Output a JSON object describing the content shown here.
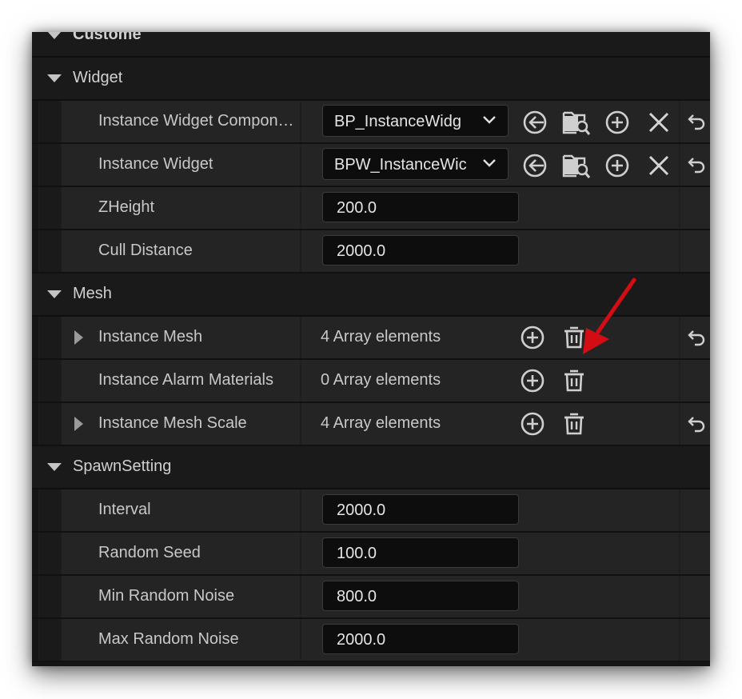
{
  "sections": {
    "custom": "Custome",
    "widget": "Widget",
    "mesh": "Mesh",
    "spawn": "SpawnSetting"
  },
  "widget_rows": {
    "component": {
      "label": "Instance Widget Compon…",
      "value": "BP_InstanceWidg"
    },
    "widget": {
      "label": "Instance Widget",
      "value": "BPW_InstanceWic"
    },
    "zheight": {
      "label": "ZHeight",
      "value": "200.0"
    },
    "cull": {
      "label": "Cull Distance",
      "value": "2000.0"
    }
  },
  "mesh_rows": {
    "mesh": {
      "label": "Instance Mesh",
      "value": "4 Array elements"
    },
    "alarm": {
      "label": "Instance Alarm Materials",
      "value": "0 Array elements"
    },
    "scale": {
      "label": "Instance Mesh Scale",
      "value": "4 Array elements"
    }
  },
  "spawn_rows": {
    "interval": {
      "label": "Interval",
      "value": "2000.0"
    },
    "seed": {
      "label": "Random Seed",
      "value": "100.0"
    },
    "min_noise": {
      "label": "Min Random Noise",
      "value": "800.0"
    },
    "max_noise": {
      "label": "Max Random Noise",
      "value": "2000.0"
    }
  },
  "icons": [
    "collapse-triangle-icon",
    "expand-triangle-icon",
    "chevron-down-icon",
    "use-selected-icon",
    "browse-folder-icon",
    "add-icon",
    "clear-icon",
    "reset-icon",
    "trash-icon",
    "red-annotation-arrow"
  ],
  "colors": {
    "panel": "#151515",
    "row": "#242424",
    "text": "#c8c8c8",
    "arrow": "#d40d14"
  }
}
